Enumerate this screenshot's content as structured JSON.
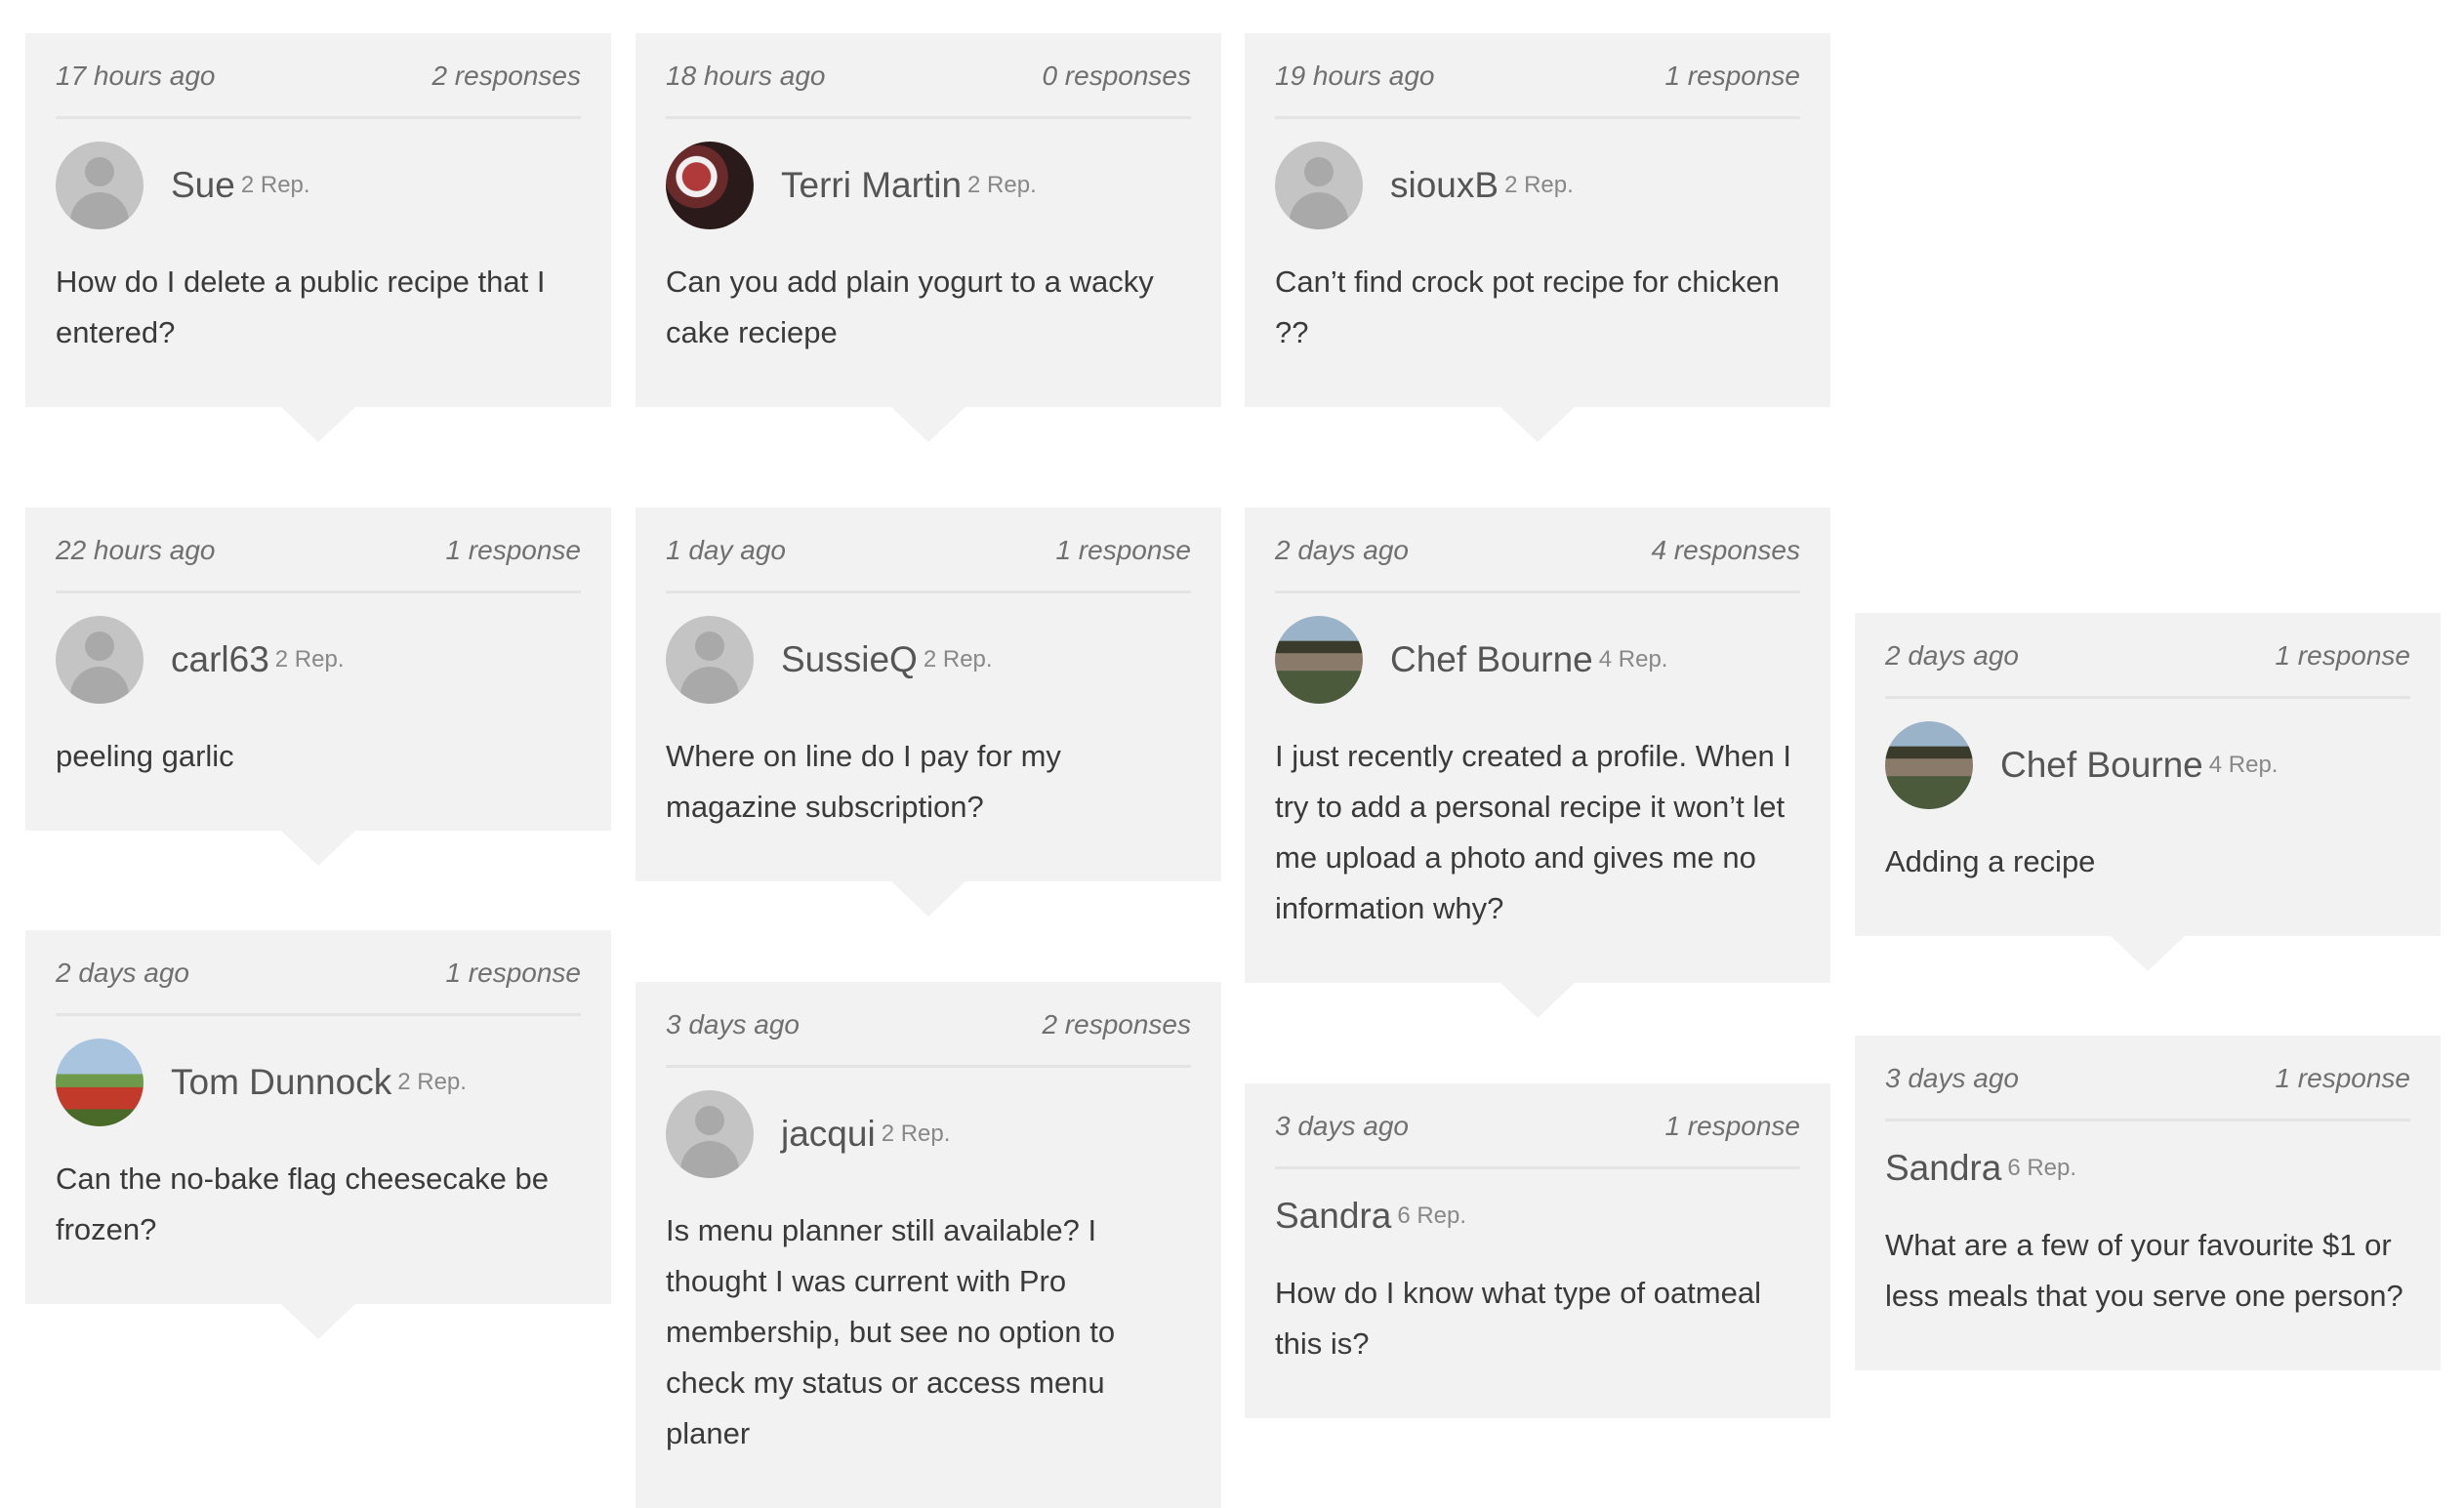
{
  "cards": [
    {
      "time": "17 hours ago",
      "responses": "2  responses",
      "user": "Sue",
      "rep": "2 Rep.",
      "avatar": "default-avatar",
      "question": "How do I delete a public recipe that I entered?"
    },
    {
      "time": "18 hours ago",
      "responses": "0  responses",
      "user": "Terri Martin",
      "rep": "2 Rep.",
      "avatar": "food-photo-avatar",
      "question": "Can you add plain yogurt to a wacky cake reciepe"
    },
    {
      "time": "19 hours ago",
      "responses": "1  response",
      "user": "siouxB",
      "rep": "2 Rep.",
      "avatar": "default-avatar",
      "question": "Can’t find crock pot recipe for chicken ??"
    },
    {
      "time": "22 hours ago",
      "responses": "1  response",
      "user": "carl63",
      "rep": "2 Rep.",
      "avatar": "default-avatar",
      "question": "peeling garlic"
    },
    {
      "time": "1 day ago",
      "responses": "1  response",
      "user": "SussieQ",
      "rep": "2 Rep.",
      "avatar": "default-avatar",
      "question": "Where on line do I pay for my magazine subscription?"
    },
    {
      "time": "2 days ago",
      "responses": "4  responses",
      "user": "Chef Bourne",
      "rep": "4 Rep.",
      "avatar": "chef-photo-avatar",
      "question": "I just recently created a profile. When I try to add a personal recipe it won’t let me upload a photo and gives me no information why?"
    },
    {
      "time": "2 days ago",
      "responses": "1  response",
      "user": "Chef Bourne",
      "rep": "4 Rep.",
      "avatar": "chef-photo-avatar",
      "question": "Adding a recipe"
    },
    {
      "time": "2 days ago",
      "responses": "1  response",
      "user": "Tom Dunnock",
      "rep": "2 Rep.",
      "avatar": "tractor-photo-avatar",
      "question": "Can the no-bake flag cheesecake be frozen?"
    },
    {
      "time": "3 days ago",
      "responses": "2  responses",
      "user": "jacqui",
      "rep": "2 Rep.",
      "avatar": "default-avatar",
      "question": "Is menu planner still available? I thought I was current with Pro membership, but see no option to check my status or access menu planer"
    },
    {
      "time": "3 days ago",
      "responses": "1  response",
      "user": "Sandra",
      "rep": "6 Rep.",
      "avatar": "",
      "question": "How do I know what type of oatmeal this is?"
    },
    {
      "time": "3 days ago",
      "responses": "1  response",
      "user": "Sandra",
      "rep": "6 Rep.",
      "avatar": "",
      "question": "What are a few of your favourite $1 or less meals that you serve one person?"
    }
  ]
}
